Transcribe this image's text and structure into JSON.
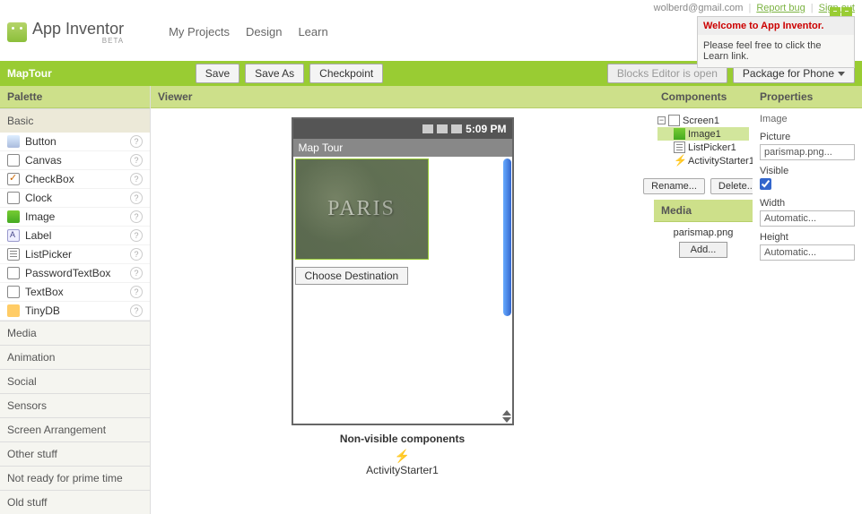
{
  "top": {
    "email": "wolberd@gmail.com",
    "report_bug": "Report bug",
    "sign_out": "Sign out"
  },
  "logo": {
    "text": "App Inventor",
    "beta": "BETA"
  },
  "nav": {
    "projects": "My Projects",
    "design": "Design",
    "learn": "Learn"
  },
  "welcome": {
    "title": "Welcome to App Inventor.",
    "body": "Please feel free to click the Learn link."
  },
  "project_name": "MapTour",
  "toolbar": {
    "save": "Save",
    "save_as": "Save As",
    "checkpoint": "Checkpoint",
    "blocks_open": "Blocks Editor is open",
    "package": "Package for Phone"
  },
  "cols": {
    "palette": "Palette",
    "viewer": "Viewer",
    "components": "Components",
    "properties": "Properties"
  },
  "palette": {
    "basic": "Basic",
    "items": [
      {
        "label": "Button",
        "icon": "ico-button"
      },
      {
        "label": "Canvas",
        "icon": "ico-canvas"
      },
      {
        "label": "CheckBox",
        "icon": "ico-check"
      },
      {
        "label": "Clock",
        "icon": "ico-clock"
      },
      {
        "label": "Image",
        "icon": "ico-image"
      },
      {
        "label": "Label",
        "icon": "ico-label"
      },
      {
        "label": "ListPicker",
        "icon": "ico-list"
      },
      {
        "label": "PasswordTextBox",
        "icon": "ico-pass"
      },
      {
        "label": "TextBox",
        "icon": "ico-text"
      },
      {
        "label": "TinyDB",
        "icon": "ico-db"
      }
    ],
    "drawers": [
      "Media",
      "Animation",
      "Social",
      "Sensors",
      "Screen Arrangement",
      "Other stuff",
      "Not ready for prime time",
      "Old stuff"
    ]
  },
  "viewer": {
    "status_time": "5:09 PM",
    "app_title": "Map Tour",
    "paris_text": "PARIS",
    "choose_label": "Choose Destination",
    "nonvis_title": "Non-visible components",
    "nonvis_item": "ActivityStarter1"
  },
  "components": {
    "tree": {
      "screen": "Screen1",
      "image": "Image1",
      "listpicker": "ListPicker1",
      "activity": "ActivityStarter1"
    },
    "rename": "Rename...",
    "delete": "Delete..."
  },
  "media": {
    "title": "Media",
    "file": "parismap.png",
    "add": "Add..."
  },
  "properties": {
    "comp_label": "Image",
    "picture_label": "Picture",
    "picture_value": "parismap.png...",
    "visible_label": "Visible",
    "width_label": "Width",
    "width_value": "Automatic...",
    "height_label": "Height",
    "height_value": "Automatic..."
  }
}
